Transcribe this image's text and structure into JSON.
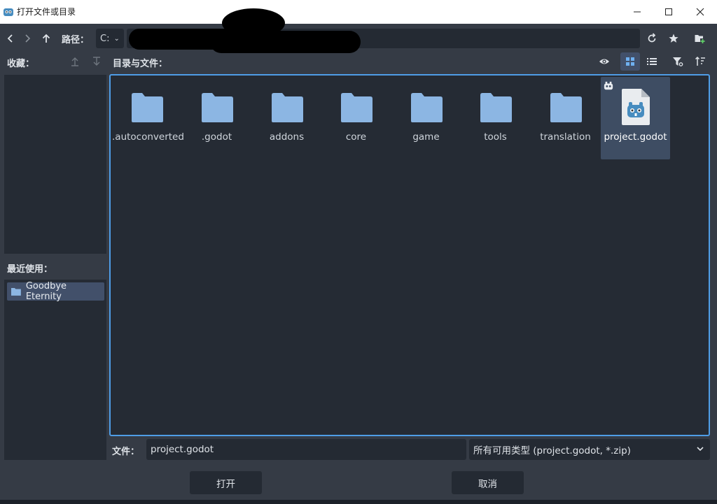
{
  "window": {
    "title": "打开文件或目录",
    "icons": {
      "app": "godot-icon",
      "minimize": "minimize-icon",
      "maximize": "maximize-icon",
      "close": "close-icon"
    }
  },
  "toolbar": {
    "path_label": "路径：",
    "drive_value": "C:",
    "path_value": "",
    "icons": [
      "back-icon",
      "forward-icon",
      "up-icon",
      "refresh-icon",
      "favorite-star-icon",
      "new-folder-icon"
    ]
  },
  "favorites": {
    "label": "收藏：",
    "items": []
  },
  "recent": {
    "label": "最近使用：",
    "items": [
      {
        "label": "Goodbye Eternity",
        "icon": "folder-icon"
      }
    ]
  },
  "files": {
    "label": "目录与文件：",
    "items": [
      {
        "name": ".autoconverted",
        "type": "folder"
      },
      {
        "name": ".godot",
        "type": "folder"
      },
      {
        "name": "addons",
        "type": "folder"
      },
      {
        "name": "core",
        "type": "folder"
      },
      {
        "name": "game",
        "type": "folder"
      },
      {
        "name": "tools",
        "type": "folder"
      },
      {
        "name": "translation",
        "type": "folder"
      },
      {
        "name": "project.godot",
        "type": "godot-project",
        "selected": true
      }
    ],
    "view_mode": "grid"
  },
  "footer": {
    "file_label": "文件：",
    "file_value": "project.godot",
    "filter_value": "所有可用类型 (project.godot, *.zip)",
    "open_label": "打开",
    "cancel_label": "取消"
  },
  "colors": {
    "accent": "#4f9de6",
    "folder": "#8cb6e3",
    "panel": "#252b34",
    "background": "#353b45"
  }
}
